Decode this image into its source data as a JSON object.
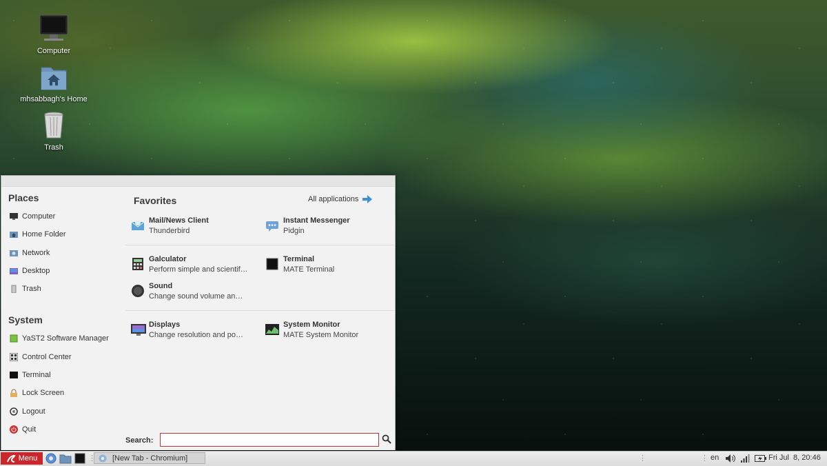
{
  "desktop": {
    "icons": [
      {
        "label": "Computer",
        "icon": "computer-icon"
      },
      {
        "label": "mhsabbagh's Home",
        "icon": "home-folder-icon"
      },
      {
        "label": "Trash",
        "icon": "trash-icon"
      }
    ]
  },
  "menu": {
    "places_title": "Places",
    "places": [
      {
        "label": "Computer",
        "icon": "computer-icon"
      },
      {
        "label": "Home Folder",
        "icon": "home-folder-icon"
      },
      {
        "label": "Network",
        "icon": "network-icon"
      },
      {
        "label": "Desktop",
        "icon": "desktop-icon"
      },
      {
        "label": "Trash",
        "icon": "trash-icon"
      }
    ],
    "system_title": "System",
    "system": [
      {
        "label": "YaST2 Software Manager",
        "icon": "package-icon"
      },
      {
        "label": "Control Center",
        "icon": "control-center-icon"
      },
      {
        "label": "Terminal",
        "icon": "terminal-icon"
      },
      {
        "label": "Lock Screen",
        "icon": "lock-icon"
      },
      {
        "label": "Logout",
        "icon": "logout-icon"
      },
      {
        "label": "Quit",
        "icon": "power-icon"
      }
    ],
    "favorites_title": "Favorites",
    "all_applications": "All applications",
    "favorites": [
      {
        "title": "Mail/News Client",
        "subtitle": "Thunderbird",
        "icon": "mail-icon"
      },
      {
        "title": "Instant Messenger",
        "subtitle": "Pidgin",
        "icon": "chat-icon"
      },
      {
        "title": "Galculator",
        "subtitle": "Perform simple and scientif…",
        "icon": "calculator-icon"
      },
      {
        "title": "Terminal",
        "subtitle": "MATE Terminal",
        "icon": "terminal-icon"
      },
      {
        "title": "Sound",
        "subtitle": "Change sound volume an…",
        "icon": "sound-icon"
      },
      {
        "title": "Displays",
        "subtitle": "Change resolution and po…",
        "icon": "display-icon"
      },
      {
        "title": "System Monitor",
        "subtitle": "MATE System Monitor",
        "icon": "system-monitor-icon"
      }
    ],
    "search_label": "Search:",
    "search_value": ""
  },
  "taskbar": {
    "menu_label": "Menu",
    "window_title": "[New Tab - Chromium]",
    "keyboard_layout": "en",
    "clock": "Fri Jul  8, 20:46"
  },
  "colors": {
    "menu_button": "#c8282c",
    "search_border": "#b33333",
    "arrow_accent": "#3d8fd6"
  }
}
